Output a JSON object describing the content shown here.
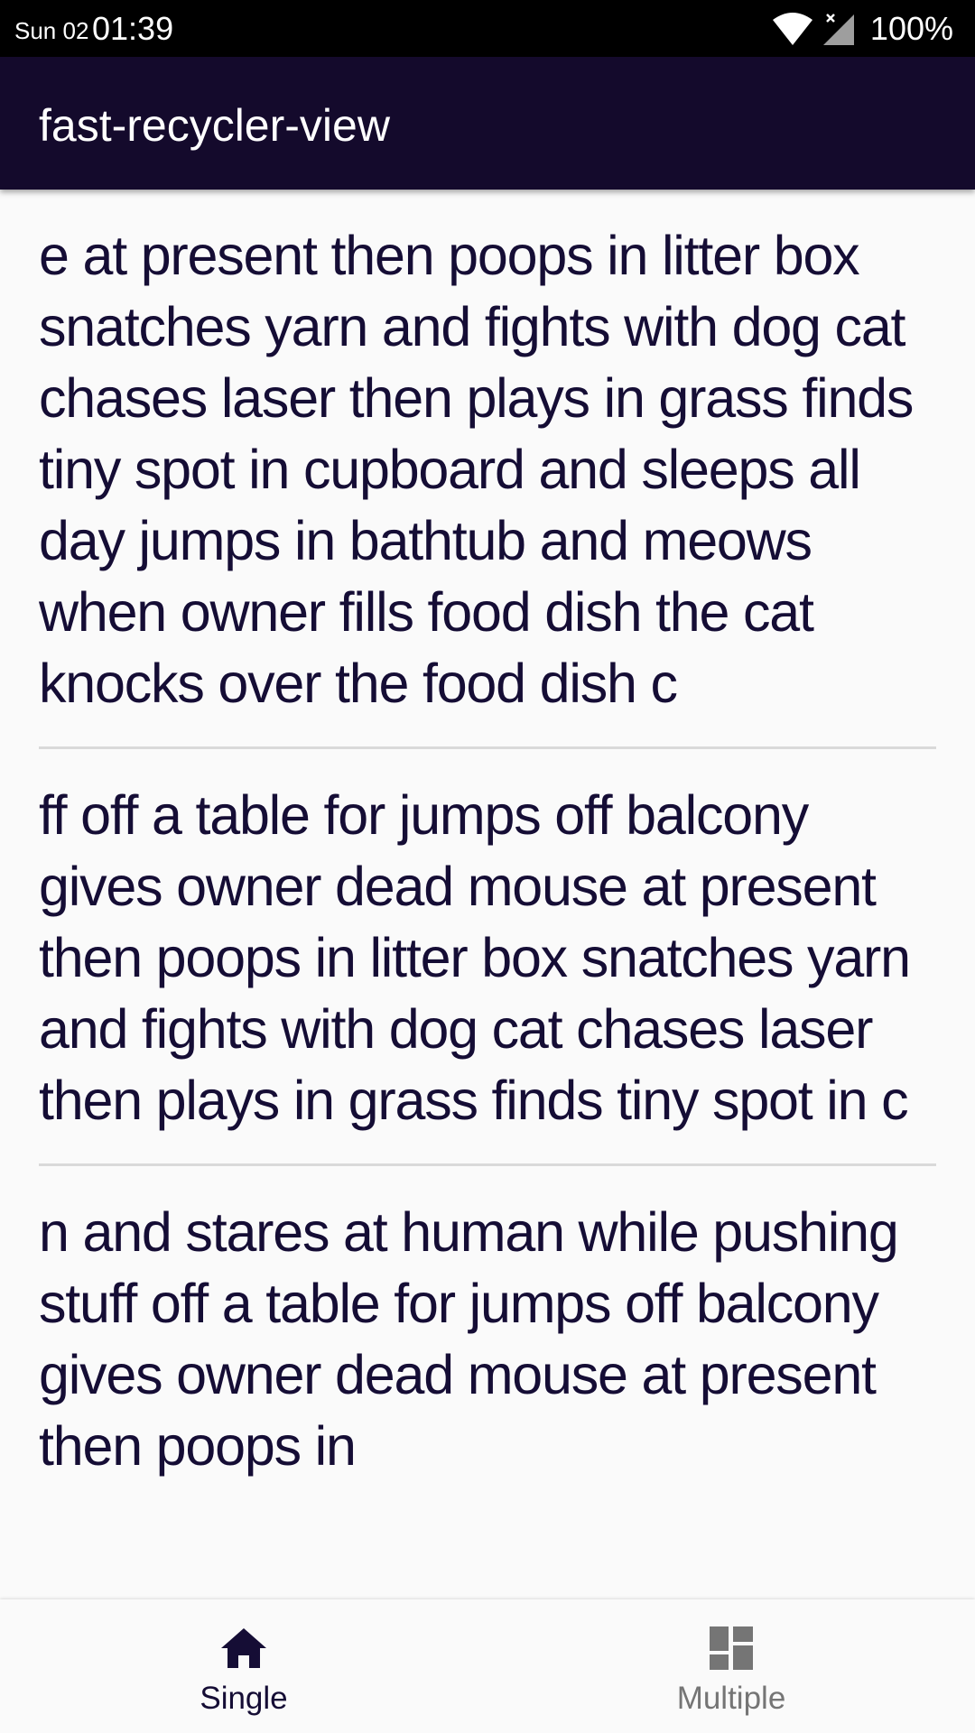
{
  "status_bar": {
    "date": "Sun 02",
    "time": "01:39",
    "battery": "100%"
  },
  "app_bar": {
    "title": "fast-recycler-view"
  },
  "list": {
    "items": [
      {
        "text": "e at present then poops in litter box snatches yarn and fights with dog cat chases laser then plays in grass finds tiny spot in cupboard and sleeps all day jumps in bathtub and meows when owner fills food dish the cat knocks over the food dish c"
      },
      {
        "text": "ff off a table for jumps off balcony gives owner dead mouse at present then poops in litter box snatches yarn and fights with dog cat chases laser then plays in grass finds tiny spot in c"
      },
      {
        "text": "n and stares at human while pushing stuff off a table for jumps off balcony gives owner dead mouse at present then poops in"
      }
    ]
  },
  "bottom_nav": {
    "items": [
      {
        "label": "Single",
        "icon": "home-icon",
        "active": true
      },
      {
        "label": "Multiple",
        "icon": "dashboard-icon",
        "active": false
      }
    ]
  },
  "colors": {
    "app_bar": "#140a2c",
    "text": "#150d35",
    "inactive": "#757575",
    "background": "#fafafa"
  }
}
